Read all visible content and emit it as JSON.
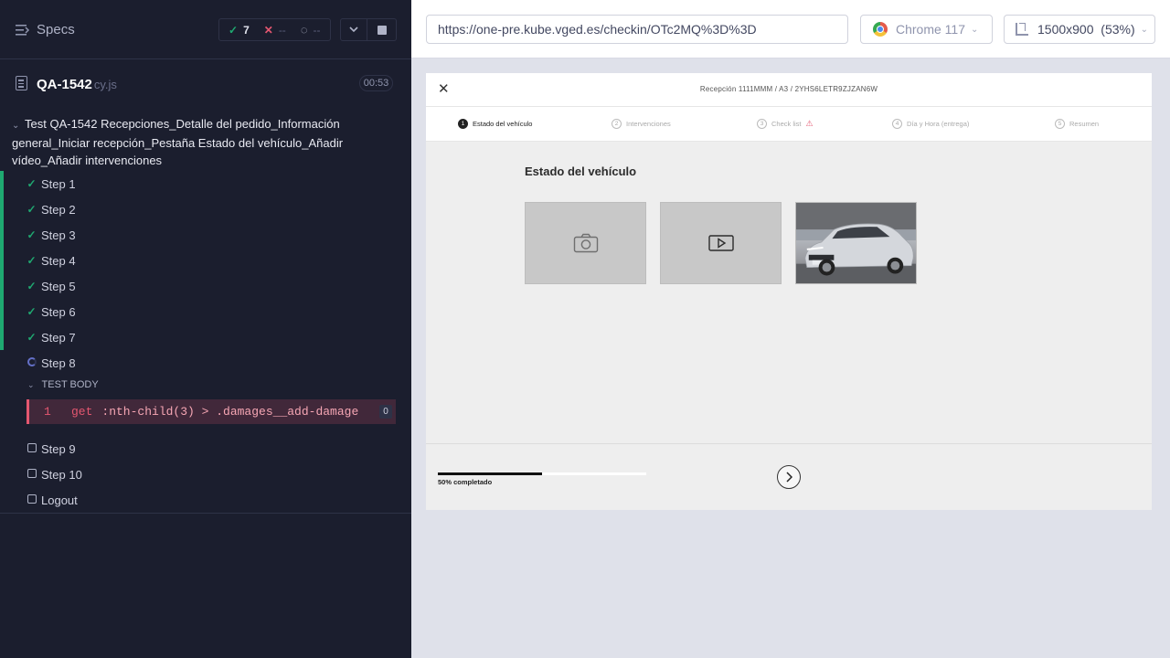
{
  "runner": {
    "specs_label": "Specs",
    "stats": {
      "passed": "7",
      "failed": "--",
      "pending": "--"
    },
    "spec": {
      "name": "QA-1542",
      "ext": "cy.js",
      "duration": "00:53"
    },
    "test_title": "Test QA-1542 Recepciones_Detalle del pedido_Información general_Iniciar recepción_Pestaña Estado del vehículo_Añadir vídeo_Añadir intervenciones",
    "steps": [
      {
        "label": "Step 1",
        "status": "passed"
      },
      {
        "label": "Step 2",
        "status": "passed"
      },
      {
        "label": "Step 3",
        "status": "passed"
      },
      {
        "label": "Step 4",
        "status": "passed"
      },
      {
        "label": "Step 5",
        "status": "passed"
      },
      {
        "label": "Step 6",
        "status": "passed"
      },
      {
        "label": "Step 7",
        "status": "passed"
      },
      {
        "label": "Step 8",
        "status": "running"
      }
    ],
    "test_body_label": "TEST BODY",
    "command": {
      "number": "1",
      "name": "get",
      "selector": ":nth-child(3) > .damages__add-damage",
      "count": "0"
    },
    "steps_after": [
      {
        "label": "Step 9",
        "status": "pending"
      },
      {
        "label": "Step 10",
        "status": "pending"
      },
      {
        "label": "Logout",
        "status": "pending"
      }
    ]
  },
  "browser_bar": {
    "url": "https://one-pre.kube.vged.es/checkin/OTc2MQ%3D%3D",
    "browser": "Chrome 117",
    "viewport": "1500x900",
    "zoom": "(53%)"
  },
  "app": {
    "header_title": "Recepción 1111MMM / A3 / 2YHS6LETR9ZJZAN6W",
    "stepper": [
      {
        "num": "1",
        "label": "Estado del vehículo",
        "active": true
      },
      {
        "num": "2",
        "label": "Intervenciones",
        "active": false
      },
      {
        "num": "3",
        "label": "Check list",
        "active": false,
        "warning": true
      },
      {
        "num": "4",
        "label": "Día y Hora (entrega)",
        "active": false
      },
      {
        "num": "5",
        "label": "Resumen",
        "active": false
      }
    ],
    "section_title": "Estado del vehículo",
    "media": [
      {
        "kind": "photo-placeholder",
        "icon": "camera-icon"
      },
      {
        "kind": "video-placeholder",
        "icon": "play-icon"
      },
      {
        "kind": "vehicle-photo",
        "icon": "car-image"
      }
    ],
    "progress": {
      "percent": 50,
      "label": "50% completado"
    },
    "colors": {
      "accent": "#111111",
      "pass": "#1fa971",
      "fail": "#e45770"
    }
  }
}
